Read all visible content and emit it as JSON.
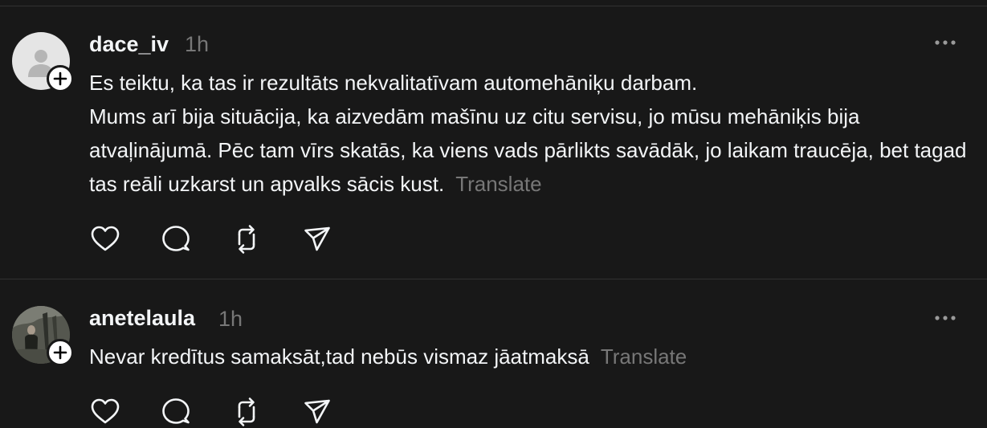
{
  "posts": [
    {
      "username": "dace_iv",
      "time": "1h",
      "lines": [
        "Es teiktu, ka tas ir rezultāts nekvalitatīvam automehāniķu darbam.",
        "Mums arī bija situācija, ka aizvedām mašīnu uz citu servisu, jo mūsu mehāniķis bija atvaļinājumā. Pēc tam vīrs skatās, ka viens vads pārlikts savādāk, jo laikam traucēja, bet tagad tas reāli uzkarst un apvalks sācis kust."
      ],
      "translate_label": "Translate",
      "avatar": "default-avatar-icon"
    },
    {
      "username": "anetelaula",
      "time": "1h",
      "lines": [
        "Nevar kredītus samaksāt,tad nebūs vismaz jāatmaksā"
      ],
      "translate_label": "Translate",
      "avatar": "photo-avatar"
    }
  ],
  "icons": {
    "like": "heart-icon",
    "reply": "comment-icon",
    "repost": "repost-icon",
    "share": "send-icon",
    "more": "more-icon",
    "follow": "plus-icon"
  },
  "colors": {
    "background": "#181818",
    "text": "#f3f5f7",
    "muted": "#777777",
    "divider": "#323232"
  }
}
